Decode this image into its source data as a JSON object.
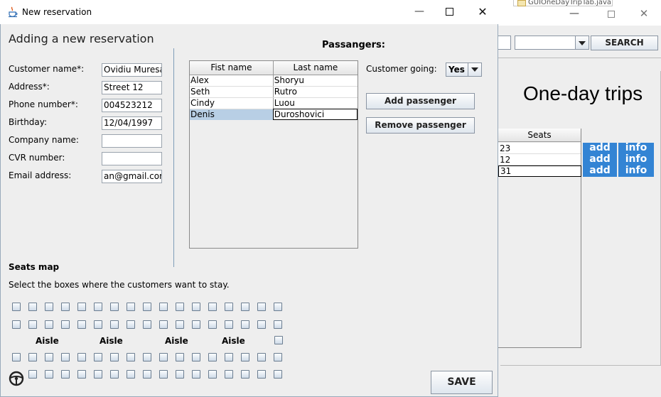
{
  "dialog": {
    "title": "New reservation",
    "heading": "Adding a new reservation",
    "fields": [
      {
        "label": "Customer name*:",
        "value": "Ovidiu Muresan"
      },
      {
        "label": "Address*:",
        "value": "Street 12"
      },
      {
        "label": "Phone number*:",
        "value": "004523212"
      },
      {
        "label": "Birthday:",
        "value": "12/04/1997"
      },
      {
        "label": "Company name:",
        "value": ""
      },
      {
        "label": "CVR number:",
        "value": ""
      },
      {
        "label": "Email address:",
        "value": "an@gmail.com"
      }
    ],
    "passengers_title": "Passangers:",
    "table": {
      "headers": [
        "Fist name",
        "Last name"
      ],
      "rows": [
        [
          "Alex",
          "Shoryu"
        ],
        [
          "Seth",
          "Rutro"
        ],
        [
          "Cindy",
          "Luou"
        ],
        [
          "Denis",
          "Duroshovici"
        ]
      ]
    },
    "customer_going_label": "Customer going:",
    "customer_going_value": "Yes",
    "add_passenger": "Add passenger",
    "remove_passenger": "Remove passenger",
    "seats_title": "Seats map",
    "seats_hint": "Select the boxes where the customers want to stay.",
    "aisle_label": "Aisle",
    "save": "SAVE"
  },
  "background_window": {
    "tab_label": "GUIOneDayTripTab.java",
    "search_button": "SEARCH",
    "page_title": "One-day trips",
    "seats_header": "Seats",
    "rows": [
      {
        "seats": "23",
        "add": "add",
        "info": "info"
      },
      {
        "seats": "12",
        "add": "add",
        "info": "info"
      },
      {
        "seats": "31",
        "add": "add",
        "info": "info"
      }
    ]
  },
  "colors": {
    "accent_blue": "#3384d4",
    "selected_row": "#b8cfe5",
    "dialog_bg": "#eeeeee"
  }
}
